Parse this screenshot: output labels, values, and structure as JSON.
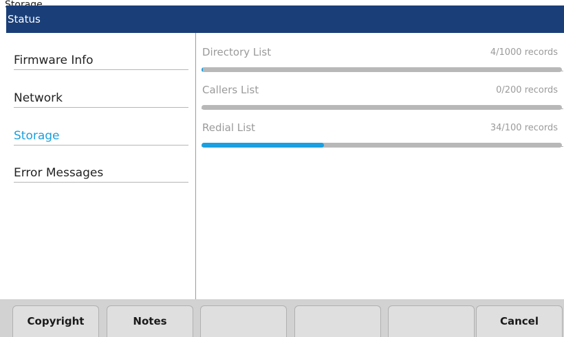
{
  "caption": "Storage",
  "header": {
    "title": "Status"
  },
  "sidebar": {
    "items": [
      {
        "label": "Firmware Info"
      },
      {
        "label": "Network"
      },
      {
        "label": "Storage"
      },
      {
        "label": "Error Messages"
      }
    ],
    "active_index": 2
  },
  "storage": {
    "rows": [
      {
        "name": "Directory List",
        "count": "4/1000 records",
        "used_fraction": 0.004
      },
      {
        "name": "Callers List",
        "count": "0/200 records",
        "used_fraction": 0.0
      },
      {
        "name": "Redial List",
        "count": "34/100 records",
        "used_fraction": 0.34
      }
    ]
  },
  "softkeys": [
    {
      "label": "Copyright"
    },
    {
      "label": "Notes"
    },
    {
      "label": ""
    },
    {
      "label": ""
    },
    {
      "label": ""
    },
    {
      "label": "Cancel"
    }
  ],
  "colors": {
    "header_bg": "#1a3f78",
    "accent": "#1aa0e0",
    "bar_track": "#b8b8b8"
  }
}
